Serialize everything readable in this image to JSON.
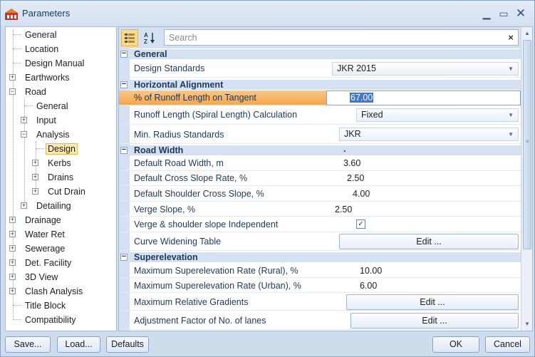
{
  "window": {
    "title": "Parameters"
  },
  "tree": [
    {
      "label": "General"
    },
    {
      "label": "Location"
    },
    {
      "label": "Design Manual"
    },
    {
      "label": "Earthworks"
    },
    {
      "label": "Road"
    },
    {
      "label": "General"
    },
    {
      "label": "Input"
    },
    {
      "label": "Analysis"
    },
    {
      "label": "Design"
    },
    {
      "label": "Kerbs"
    },
    {
      "label": "Drains"
    },
    {
      "label": "Cut Drain"
    },
    {
      "label": "Detailing"
    },
    {
      "label": "Drainage"
    },
    {
      "label": "Water Ret"
    },
    {
      "label": "Sewerage"
    },
    {
      "label": "Det. Facility"
    },
    {
      "label": "3D View"
    },
    {
      "label": "Clash Analysis"
    },
    {
      "label": "Title Block"
    },
    {
      "label": "Compatibility"
    }
  ],
  "toolbar": {
    "categorized_icon": "categorized-icon",
    "alpha_icon": "sort-az-icon",
    "search_placeholder": "Search",
    "clear_label": "×"
  },
  "grid": {
    "categories": [
      {
        "label": "General"
      },
      {
        "label": "Horizontal Alignment"
      },
      {
        "label": "Road Width"
      },
      {
        "label": "Superelevation"
      }
    ],
    "road_width_marker": ".",
    "rows": [
      {
        "name": "Design Standards",
        "value": "JKR 2015"
      },
      {
        "name": "% of Runoff Length on Tangent",
        "value": "67.00"
      },
      {
        "name": "Runoff Length (Spiral Length) Calculation",
        "value": "Fixed"
      },
      {
        "name": "Min. Radius Standards",
        "value": "JKR"
      },
      {
        "name": "Default Road Width, m",
        "value": "3.60"
      },
      {
        "name": "Default Cross Slope Rate, %",
        "value": "2.50"
      },
      {
        "name": "Default Shoulder Cross Slope, %",
        "value": "4.00"
      },
      {
        "name": "Verge Slope, %",
        "value": "2.50"
      },
      {
        "name": "Verge & shoulder slope Independent",
        "value": "✓"
      },
      {
        "name": "Curve Widening Table",
        "value": "Edit ..."
      },
      {
        "name": "Maximum Superelevation Rate (Rural), %",
        "value": "10.00"
      },
      {
        "name": "Maximum Superelevation Rate (Urban), %",
        "value": "6.00"
      },
      {
        "name": "Maximum Relative Gradients",
        "value": "Edit ..."
      },
      {
        "name": "Adjustment Factor of No. of lanes",
        "value": "Edit ..."
      }
    ]
  },
  "buttons": {
    "save": "Save...",
    "load": "Load...",
    "defaults": "Defaults",
    "ok": "OK",
    "cancel": "Cancel"
  },
  "colors": {
    "accent": "#f4a64e",
    "selection": "#3f78d0",
    "header": "#d5e1f0"
  }
}
